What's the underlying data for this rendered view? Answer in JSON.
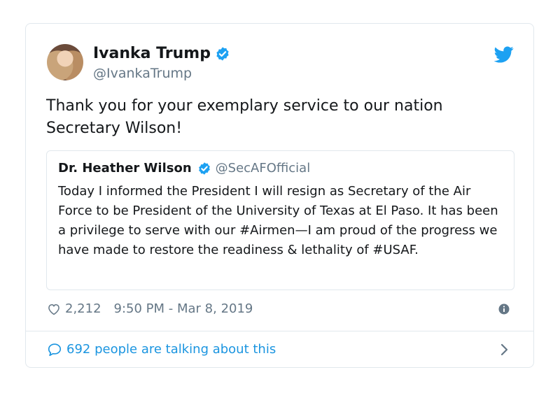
{
  "author": {
    "name": "Ivanka Trump",
    "handle": "@IvankaTrump"
  },
  "tweet": {
    "text": "Thank you for your exemplary service to our nation Secretary Wilson!"
  },
  "quoted_tweet": {
    "name": "Dr. Heather Wilson",
    "handle": "@SecAFOfficial",
    "text": "Today I informed the President I will resign as Secretary of the Air Force to be President of the University of Texas at El Paso. It has been a privilege to serve with our #Airmen—I am proud of the progress we have made to restore the readiness & lethality of #USAF."
  },
  "meta": {
    "likes": "2,212",
    "timestamp": "9:50 PM - Mar 8, 2019"
  },
  "footer": {
    "talking_text": "692 people are talking about this"
  },
  "colors": {
    "twitter_blue": "#1da1f2",
    "link_blue": "#1b95e0",
    "secondary_text": "#657786",
    "border": "#e1e8ed"
  },
  "icons": [
    "verified-badge-icon",
    "twitter-bird-icon",
    "heart-icon",
    "info-icon",
    "comment-bubble-icon",
    "chevron-right-icon"
  ]
}
